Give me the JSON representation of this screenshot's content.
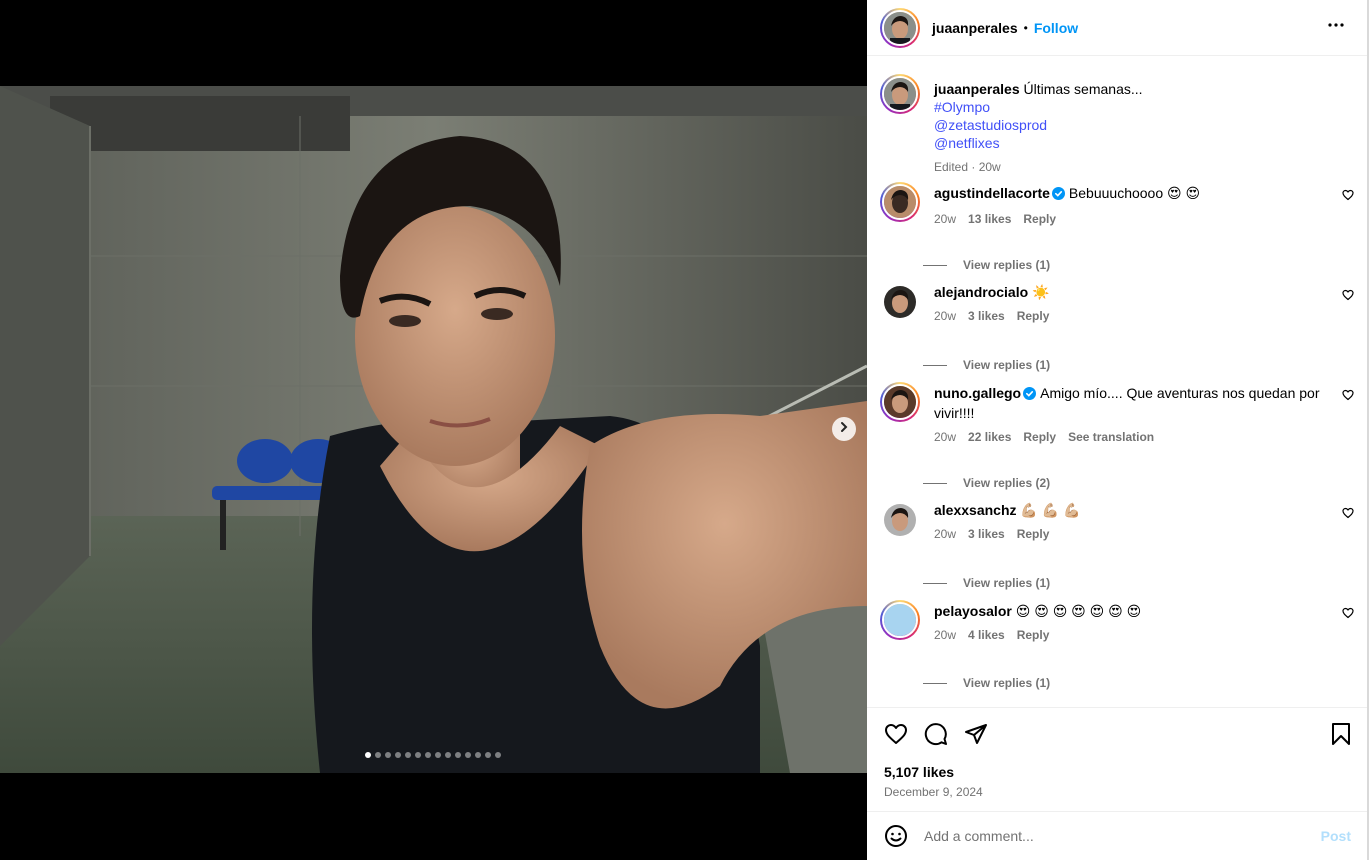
{
  "post": {
    "username": "juaanperales",
    "follow_label": "Follow",
    "separator": "•",
    "caption_text": "Últimas semanas...",
    "caption_tags": [
      "#Olympo",
      "@zetastudiosprod",
      "@netflixes"
    ],
    "caption_meta": "Edited · 20w",
    "likes": "5,107 likes",
    "date": "December 9, 2024",
    "carousel_total": 14,
    "carousel_active": 0
  },
  "comments": [
    {
      "user": "agustindellacorte",
      "verified": true,
      "text": "Bebuuuchoooo 😍 😍",
      "time": "20w",
      "likes": "13 likes",
      "reply": "Reply",
      "view_replies": "View replies (1)",
      "ring": true
    },
    {
      "user": "alejandrocialo",
      "verified": false,
      "text": "☀️",
      "time": "20w",
      "likes": "3 likes",
      "reply": "Reply",
      "view_replies": "View replies (1)",
      "ring": false
    },
    {
      "user": "nuno.gallego",
      "verified": true,
      "text": "Amigo mío.... Que aventuras nos quedan por vivir!!!!",
      "time": "20w",
      "likes": "22 likes",
      "reply": "Reply",
      "translate": "See translation",
      "view_replies": "View replies (2)",
      "ring": true
    },
    {
      "user": "alexxsanchz",
      "verified": false,
      "text": "💪🏼 💪🏼 💪🏼",
      "time": "20w",
      "likes": "3 likes",
      "reply": "Reply",
      "view_replies": "View replies (1)",
      "ring": false
    },
    {
      "user": "pelayosalor",
      "verified": false,
      "text": "😍 😍 😍 😍 😍 😍 😍",
      "time": "20w",
      "likes": "4 likes",
      "reply": "Reply",
      "view_replies": "View replies (1)",
      "ring": true
    }
  ],
  "composer": {
    "placeholder": "Add a comment...",
    "post_label": "Post"
  },
  "icons": [
    "more-options-icon",
    "heart-icon",
    "comment-icon",
    "share-icon",
    "bookmark-icon",
    "emoji-icon",
    "verified-icon",
    "chevron-right-icon"
  ]
}
